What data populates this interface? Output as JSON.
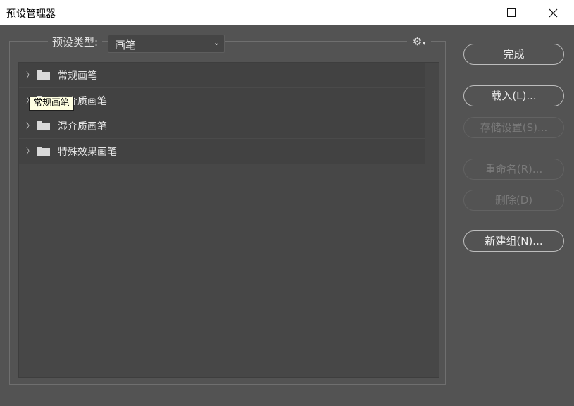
{
  "window": {
    "title": "预设管理器"
  },
  "preset": {
    "label": "预设类型:",
    "selected": "画笔"
  },
  "list": {
    "items": [
      {
        "label": "常规画笔"
      },
      {
        "label": "干介质画笔"
      },
      {
        "label": "湿介质画笔"
      },
      {
        "label": "特殊效果画笔"
      }
    ]
  },
  "tooltip": {
    "text": "常规画笔"
  },
  "buttons": {
    "done": "完成",
    "load": "载入(L)...",
    "save": "存储设置(S)...",
    "rename": "重命名(R)...",
    "delete": "删除(D)",
    "new_group": "新建组(N)..."
  },
  "icons": {
    "folder": "folder-icon",
    "gear": "gear-icon",
    "expander": "chevron-right-icon"
  }
}
